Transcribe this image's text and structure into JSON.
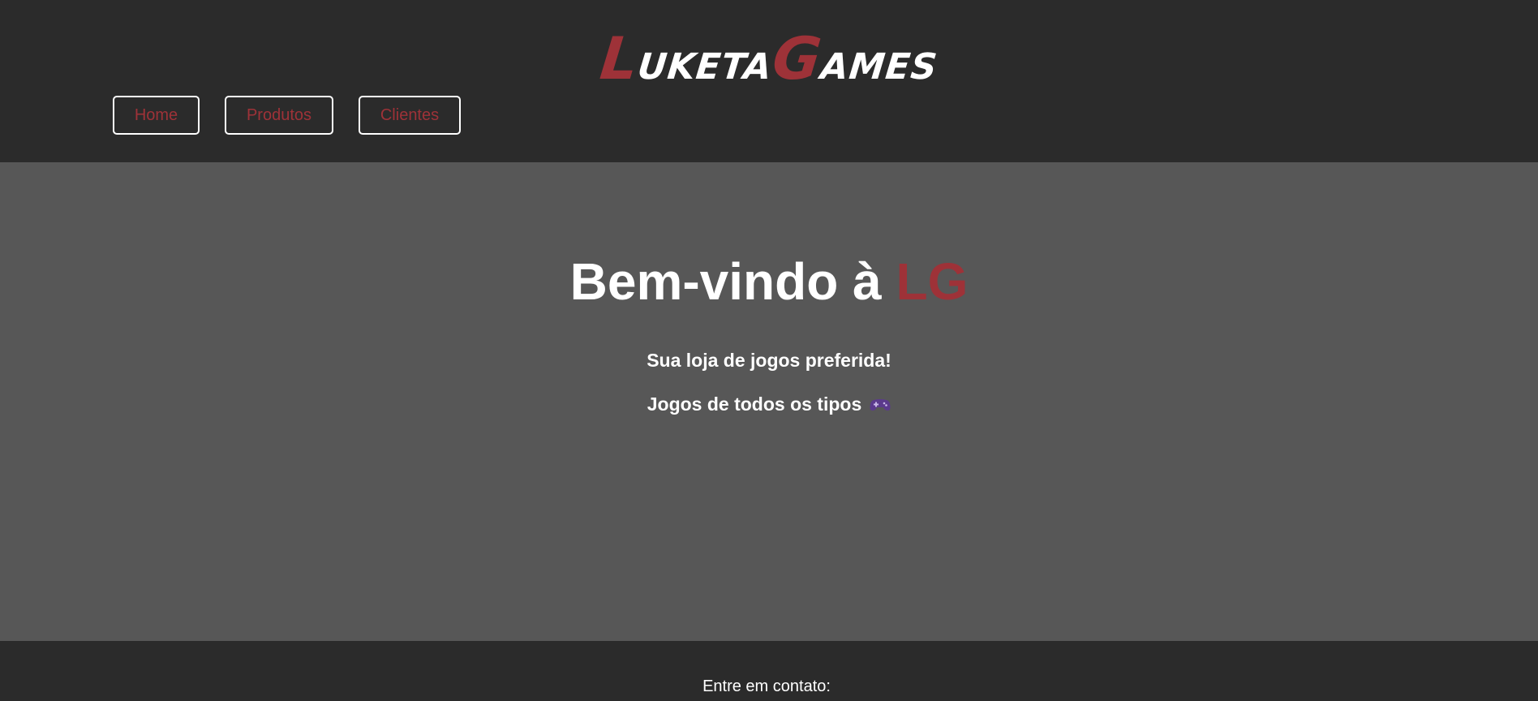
{
  "header": {
    "logo": {
      "first_initial": "L",
      "first_rest": "uketa",
      "second_initial": "G",
      "second_rest": "ames"
    },
    "nav": {
      "home": "Home",
      "produtos": "Produtos",
      "clientes": "Clientes"
    }
  },
  "main": {
    "welcome_prefix": "Bem-vindo à ",
    "welcome_brand": "LG",
    "tagline_1": "Sua loja de jogos preferida!",
    "tagline_2": "Jogos de todos os tipos",
    "tagline_2_icon": "gamepad-icon"
  },
  "footer": {
    "contact_label": "Entre em contato:"
  },
  "colors": {
    "background_dark": "#2b2b2b",
    "background_main": "#575757",
    "accent": "#9e3238",
    "text": "#ffffff",
    "gamepad": "#5b3a8c"
  }
}
